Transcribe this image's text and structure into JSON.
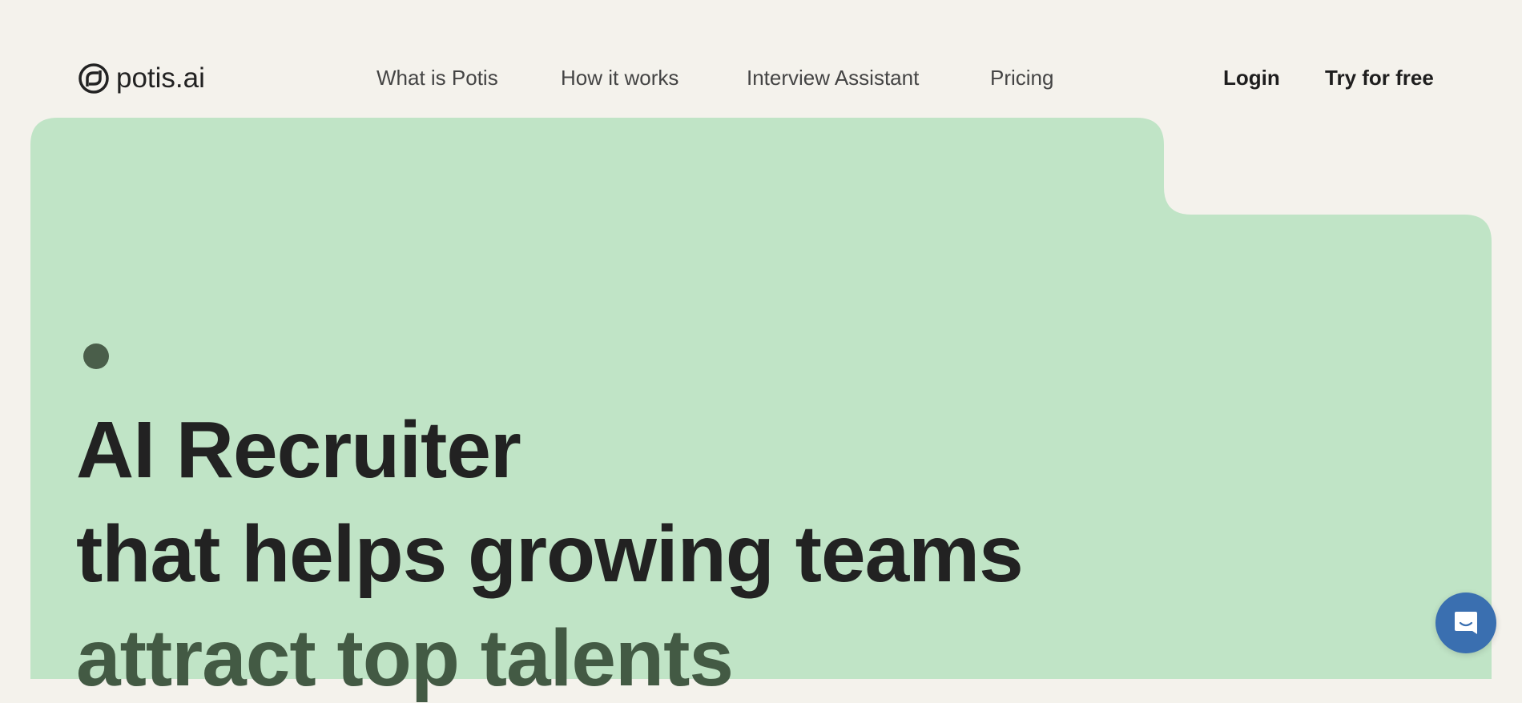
{
  "brand": {
    "name": "potis.ai",
    "icon": "potis-logo-icon"
  },
  "nav": {
    "items": [
      {
        "label": "What is Potis"
      },
      {
        "label": "How it works"
      },
      {
        "label": "Interview Assistant"
      },
      {
        "label": "Pricing"
      }
    ]
  },
  "auth": {
    "login": "Login",
    "try_free": "Try for free"
  },
  "hero": {
    "line1": "AI Recruiter",
    "line2": "that helps growing teams",
    "line3": "attract top talents"
  },
  "chat": {
    "icon": "chat-bubble-icon"
  },
  "colors": {
    "background": "#f4f2ec",
    "panel": "#c0e4c6",
    "accent_dark": "#435a44",
    "text": "#222222",
    "chat": "#3a6fb0"
  }
}
